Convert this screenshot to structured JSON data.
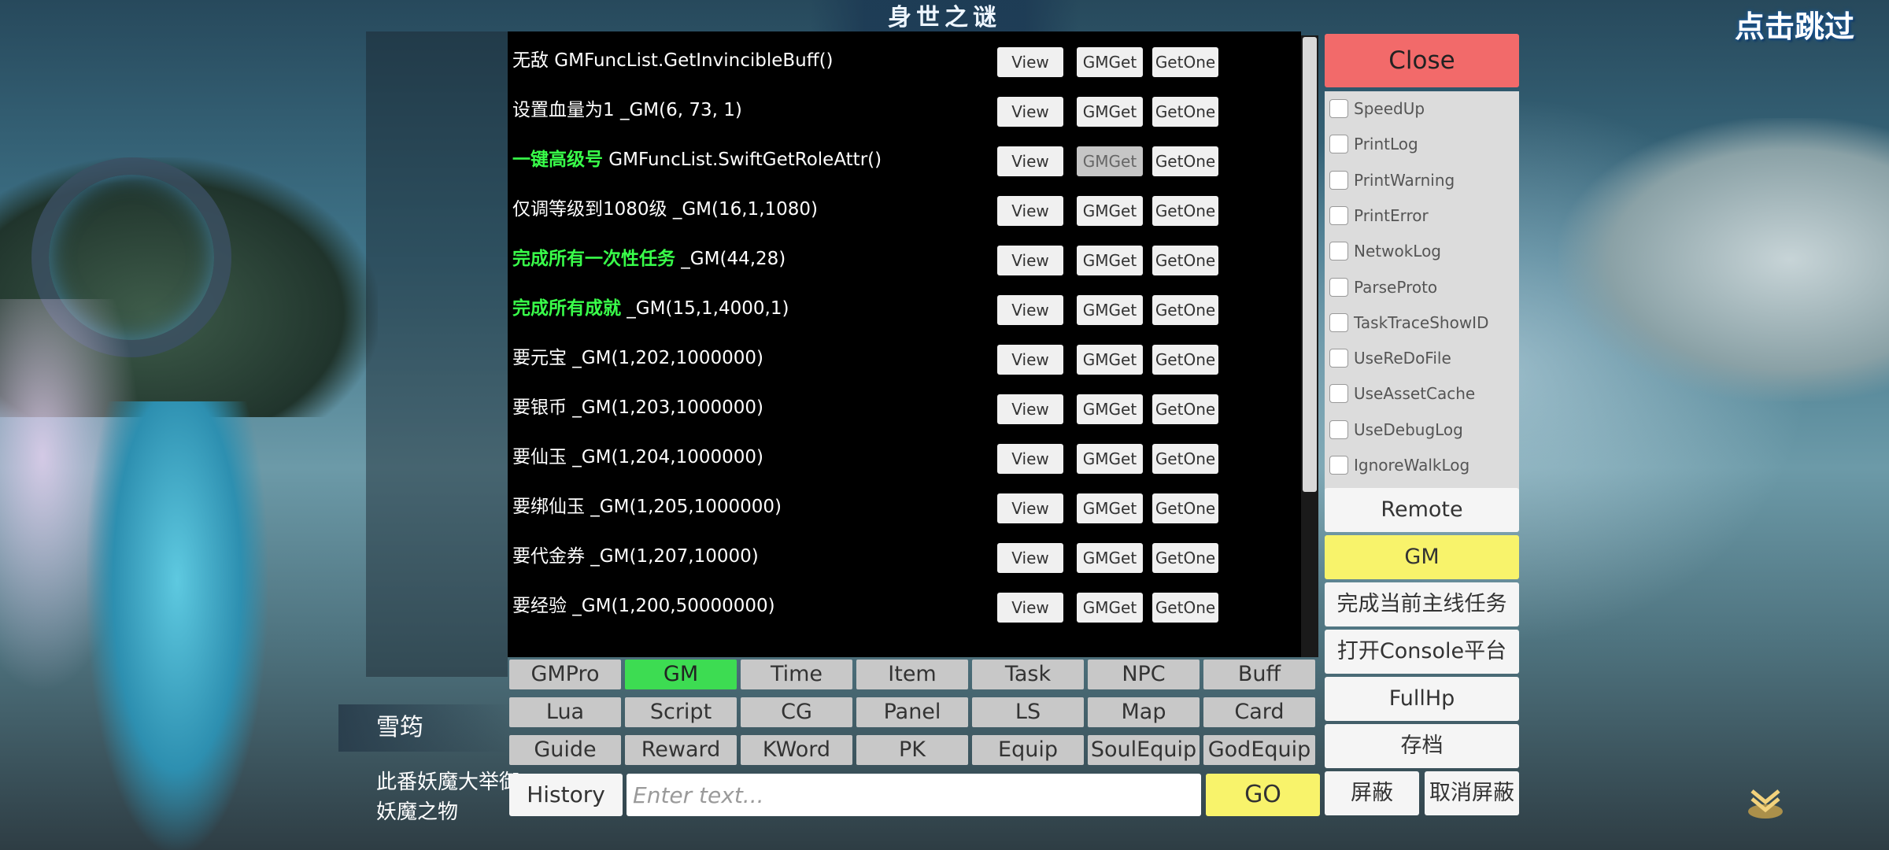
{
  "scene": {
    "title": "身世之谜",
    "skip_label": "点击跳过",
    "speaker_name": "雪筠",
    "dialog_text": "此番妖魔大举御妖魔之物"
  },
  "gm_rows": [
    {
      "hl": "",
      "text": "无敌 GMFuncList.GetInvincibleBuff()"
    },
    {
      "hl": "",
      "text": "设置血量为1 _GM(6, 73, 1)"
    },
    {
      "hl": "一键高级号",
      "text": " GMFuncList.SwiftGetRoleAttr()"
    },
    {
      "hl": "",
      "text": "仅调等级到1080级 _GM(16,1,1080)"
    },
    {
      "hl": "完成所有一次性任务",
      "text": " _GM(44,28)"
    },
    {
      "hl": "完成所有成就",
      "text": " _GM(15,1,4000,1)"
    },
    {
      "hl": "",
      "text": "要元宝 _GM(1,202,1000000)"
    },
    {
      "hl": "",
      "text": "要银币 _GM(1,203,1000000)"
    },
    {
      "hl": "",
      "text": "要仙玉 _GM(1,204,1000000)"
    },
    {
      "hl": "",
      "text": "要绑仙玉 _GM(1,205,1000000)"
    },
    {
      "hl": "",
      "text": "要代金券 _GM(1,207,10000)"
    },
    {
      "hl": "",
      "text": "要经验 _GM(1,200,50000000)"
    }
  ],
  "row_buttons": {
    "view": "View",
    "gmget": "GMGet",
    "getone": "GetOne"
  },
  "tabs": [
    "GMPro",
    "GM",
    "Time",
    "Item",
    "Task",
    "NPC",
    "Buff",
    "Lua",
    "Script",
    "CG",
    "Panel",
    "LS",
    "Map",
    "Card",
    "Guide",
    "Reward",
    "KWord",
    "PK",
    "Equip",
    "SoulEquip",
    "GodEquip"
  ],
  "active_tab": "GM",
  "command": {
    "history_label": "History",
    "placeholder": "Enter text...",
    "go_label": "GO"
  },
  "side": {
    "close_label": "Close",
    "checkboxes": [
      "SpeedUp",
      "PrintLog",
      "PrintWarning",
      "PrintError",
      "NetwokLog",
      "ParseProto",
      "TaskTraceShowID",
      "UseReDoFile",
      "UseAssetCache",
      "UseDebugLog",
      "IgnoreWalkLog"
    ],
    "buttons": [
      "Remote",
      "GM",
      "完成当前主线任务",
      "打开Console平台",
      "FullHp",
      "存档"
    ],
    "shield_label": "屏蔽",
    "unshield_label": "取消屏蔽"
  },
  "colors": {
    "active_tab": "#3ddc52",
    "close": "#f26a6a",
    "highlight_text": "#39ff4a",
    "go": "#f8f36b"
  }
}
